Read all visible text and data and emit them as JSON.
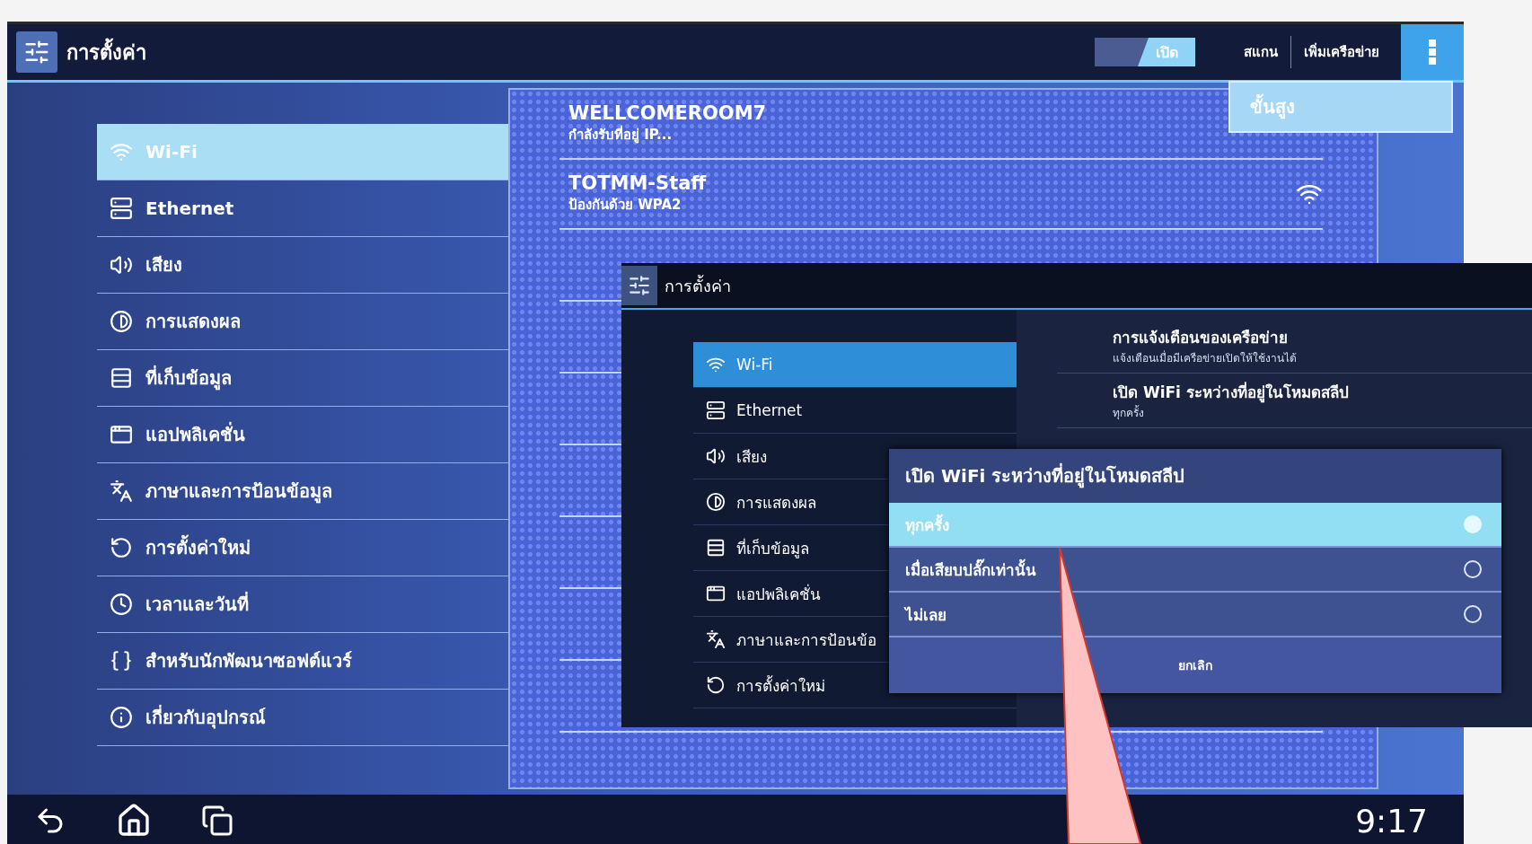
{
  "app_bar": {
    "title": "การตั้งค่า",
    "wifi_switch": {
      "label": "เปิด",
      "on": true
    },
    "actions": [
      "สแกน",
      "เพิ่มเครือข่าย"
    ]
  },
  "overflow_menu": {
    "items": [
      "ขั้นสูง"
    ]
  },
  "sidebar": {
    "items": [
      {
        "label": "Wi-Fi",
        "selected": true
      },
      {
        "label": "Ethernet",
        "selected": false
      },
      {
        "label": "เสียง",
        "selected": false
      },
      {
        "label": "การแสดงผล",
        "selected": false
      },
      {
        "label": "ที่เก็บข้อมูล",
        "selected": false
      },
      {
        "label": "แอปพลิเคชั่น",
        "selected": false
      },
      {
        "label": "ภาษาและการป้อนข้อมูล",
        "selected": false
      },
      {
        "label": "การตั้งค่าใหม่",
        "selected": false
      },
      {
        "label": "เวลาและวันที่",
        "selected": false
      },
      {
        "label": "สำหรับนักพัฒนาซอฟต์แวร์",
        "selected": false
      },
      {
        "label": "เกี่ยวกับอุปกรณ์",
        "selected": false
      }
    ]
  },
  "networks": [
    {
      "name": "WELLCOMEROOM7",
      "status": "กำลังรับที่อยู่ IP...",
      "signal_icon": false
    },
    {
      "name": "TOTMM-Staff",
      "status": "ป้องกันด้วย WPA2",
      "signal_icon": true
    }
  ],
  "navigation_bar": {
    "clock": "9:17"
  },
  "inset": {
    "app_bar": {
      "title": "การตั้งค่า"
    },
    "sidebar": {
      "items": [
        {
          "label": "Wi-Fi",
          "selected": true
        },
        {
          "label": "Ethernet",
          "selected": false
        },
        {
          "label": "เสียง",
          "selected": false
        },
        {
          "label": "การแสดงผล",
          "selected": false
        },
        {
          "label": "ที่เก็บข้อมูล",
          "selected": false
        },
        {
          "label": "แอปพลิเคชั่น",
          "selected": false
        },
        {
          "label": "ภาษาและการป้อนข้อ",
          "selected": false
        },
        {
          "label": "การตั้งค่าใหม่",
          "selected": false
        }
      ]
    },
    "preferences": [
      {
        "title": "การแจ้งเตือนของเครือข่าย",
        "summary": "แจ้งเตือนเมื่อมีเครือข่ายเปิดให้ใช้งานได้"
      },
      {
        "title": "เปิด WiFi ระหว่างที่อยู่ในโหมดสลีป",
        "summary": "ทุกครั้ง"
      }
    ],
    "dialog": {
      "title": "เปิด WiFi ระหว่างที่อยู่ในโหมดสลีป",
      "options": [
        {
          "label": "ทุกครั้ง",
          "selected": true
        },
        {
          "label": "เมื่อเสียบปลั๊กเท่านั้น",
          "selected": false
        },
        {
          "label": "ไม่เลย",
          "selected": false
        }
      ],
      "cancel": "ยกเลิก"
    }
  }
}
